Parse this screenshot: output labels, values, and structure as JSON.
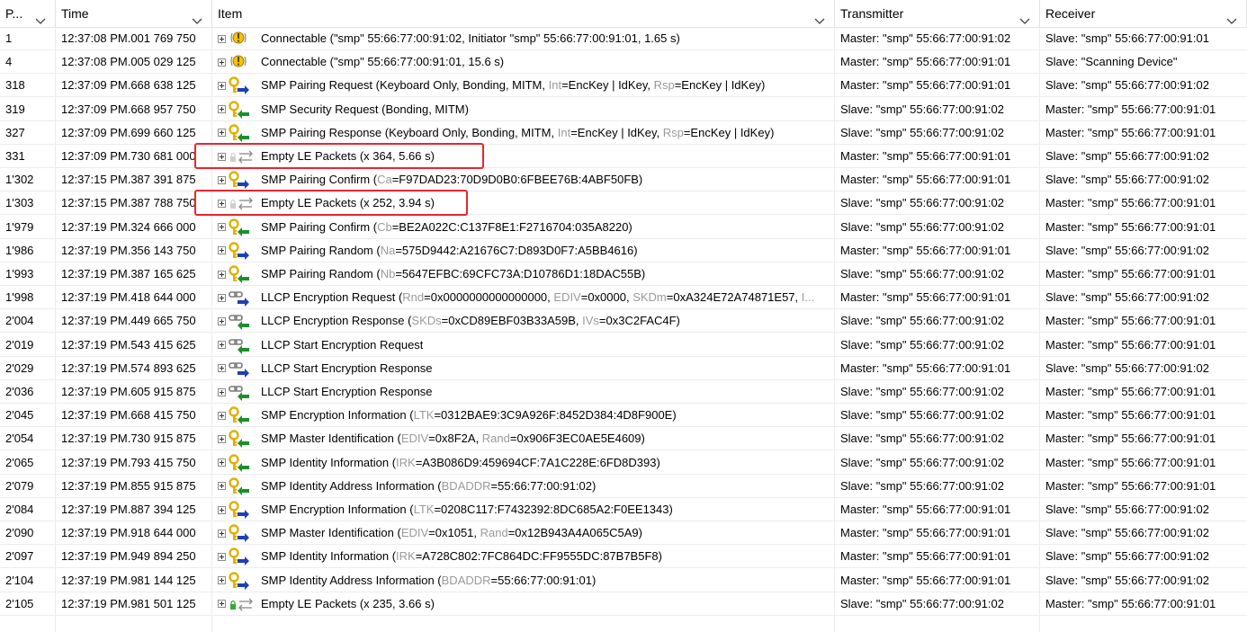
{
  "columns": [
    {
      "key": "packet",
      "label": "P..."
    },
    {
      "key": "time",
      "label": "Time"
    },
    {
      "key": "item",
      "label": "Item"
    },
    {
      "key": "transmitter",
      "label": "Transmitter"
    },
    {
      "key": "receiver",
      "label": "Receiver"
    }
  ],
  "rows": [
    {
      "packet": "1",
      "time": "12:37:08 PM.001 769 750",
      "icon": "connectable-icon",
      "parts": [
        [
          "Connectable (\"smp\" 55:66:77:00:91:02, Initiator \"smp\" 55:66:77:00:91:01, 1.65 s)",
          false
        ]
      ],
      "transmitter": "Master: \"smp\" 55:66:77:00:91:02",
      "receiver": "Slave: \"smp\" 55:66:77:00:91:01"
    },
    {
      "packet": "4",
      "time": "12:37:08 PM.005 029 125",
      "icon": "connectable-icon",
      "parts": [
        [
          "Connectable (\"smp\" 55:66:77:00:91:01, 15.6 s)",
          false
        ]
      ],
      "transmitter": "Master: \"smp\" 55:66:77:00:91:01",
      "receiver": "Slave: \"Scanning Device\""
    },
    {
      "packet": "318",
      "time": "12:37:09 PM.668 638 125",
      "icon": "smp-key-right-icon",
      "parts": [
        [
          "SMP Pairing Request (Keyboard Only, Bonding, MITM, ",
          false
        ],
        [
          "Int",
          true
        ],
        [
          "=EncKey | IdKey, ",
          false
        ],
        [
          "Rsp",
          true
        ],
        [
          "=EncKey | IdKey)",
          false
        ]
      ],
      "transmitter": "Master: \"smp\" 55:66:77:00:91:01",
      "receiver": "Slave: \"smp\" 55:66:77:00:91:02"
    },
    {
      "packet": "319",
      "time": "12:37:09 PM.668 957 750",
      "icon": "smp-key-left-icon",
      "parts": [
        [
          "SMP Security Request (Bonding, MITM)",
          false
        ]
      ],
      "transmitter": "Slave: \"smp\" 55:66:77:00:91:02",
      "receiver": "Master: \"smp\" 55:66:77:00:91:01"
    },
    {
      "packet": "327",
      "time": "12:37:09 PM.699 660 125",
      "icon": "smp-key-left-icon",
      "parts": [
        [
          "SMP Pairing Response (Keyboard Only, Bonding, MITM, ",
          false
        ],
        [
          "Int",
          true
        ],
        [
          "=EncKey | IdKey, ",
          false
        ],
        [
          "Rsp",
          true
        ],
        [
          "=EncKey | IdKey)",
          false
        ]
      ],
      "transmitter": "Slave: \"smp\" 55:66:77:00:91:02",
      "receiver": "Master: \"smp\" 55:66:77:00:91:01"
    },
    {
      "packet": "331",
      "time": "12:37:09 PM.730 681 000",
      "icon": "empty-packets-icon",
      "parts": [
        [
          "Empty LE Packets (x 364, 5.66 s)",
          false
        ]
      ],
      "transmitter": "Master: \"smp\" 55:66:77:00:91:01",
      "receiver": "Slave: \"smp\" 55:66:77:00:91:02"
    },
    {
      "packet": "1'302",
      "time": "12:37:15 PM.387 391 875",
      "icon": "smp-key-right-icon",
      "parts": [
        [
          "SMP Pairing Confirm (",
          false
        ],
        [
          "Ca",
          true
        ],
        [
          "=F97DAD23:70D9D0B0:6FBEE76B:4ABF50FB)",
          false
        ]
      ],
      "transmitter": "Master: \"smp\" 55:66:77:00:91:01",
      "receiver": "Slave: \"smp\" 55:66:77:00:91:02"
    },
    {
      "packet": "1'303",
      "time": "12:37:15 PM.387 788 750",
      "icon": "empty-packets-icon",
      "parts": [
        [
          "Empty LE Packets (x 252, 3.94 s)",
          false
        ]
      ],
      "transmitter": "Slave: \"smp\" 55:66:77:00:91:02",
      "receiver": "Master: \"smp\" 55:66:77:00:91:01"
    },
    {
      "packet": "1'979",
      "time": "12:37:19 PM.324 666 000",
      "icon": "smp-key-left-icon",
      "parts": [
        [
          "SMP Pairing Confirm (",
          false
        ],
        [
          "Cb",
          true
        ],
        [
          "=BE2A022C:C137F8E1:F2716704:035A8220)",
          false
        ]
      ],
      "transmitter": "Slave: \"smp\" 55:66:77:00:91:02",
      "receiver": "Master: \"smp\" 55:66:77:00:91:01"
    },
    {
      "packet": "1'986",
      "time": "12:37:19 PM.356 143 750",
      "icon": "smp-key-right-icon",
      "parts": [
        [
          "SMP Pairing Random (",
          false
        ],
        [
          "Na",
          true
        ],
        [
          "=575D9442:A21676C7:D893D0F7:A5BB4616)",
          false
        ]
      ],
      "transmitter": "Master: \"smp\" 55:66:77:00:91:01",
      "receiver": "Slave: \"smp\" 55:66:77:00:91:02"
    },
    {
      "packet": "1'993",
      "time": "12:37:19 PM.387 165 625",
      "icon": "smp-key-left-icon",
      "parts": [
        [
          "SMP Pairing Random (",
          false
        ],
        [
          "Nb",
          true
        ],
        [
          "=5647EFBC:69CFC73A:D10786D1:18DAC55B)",
          false
        ]
      ],
      "transmitter": "Slave: \"smp\" 55:66:77:00:91:02",
      "receiver": "Master: \"smp\" 55:66:77:00:91:01"
    },
    {
      "packet": "1'998",
      "time": "12:37:19 PM.418 644 000",
      "icon": "llcp-right-icon",
      "parts": [
        [
          "LLCP Encryption Request (",
          false
        ],
        [
          "Rnd",
          true
        ],
        [
          "=0x0000000000000000, ",
          false
        ],
        [
          "EDIV",
          true
        ],
        [
          "=0x0000, ",
          false
        ],
        [
          "SKDm",
          true
        ],
        [
          "=0xA324E72A74871E57, ",
          false
        ],
        [
          "I...",
          true
        ]
      ],
      "transmitter": "Master: \"smp\" 55:66:77:00:91:01",
      "receiver": "Slave: \"smp\" 55:66:77:00:91:02"
    },
    {
      "packet": "2'004",
      "time": "12:37:19 PM.449 665 750",
      "icon": "llcp-left-icon",
      "parts": [
        [
          "LLCP Encryption Response (",
          false
        ],
        [
          "SKDs",
          true
        ],
        [
          "=0xCD89EBF03B33A59B, ",
          false
        ],
        [
          "IVs",
          true
        ],
        [
          "=0x3C2FAC4F)",
          false
        ]
      ],
      "transmitter": "Slave: \"smp\" 55:66:77:00:91:02",
      "receiver": "Master: \"smp\" 55:66:77:00:91:01"
    },
    {
      "packet": "2'019",
      "time": "12:37:19 PM.543 415 625",
      "icon": "llcp-left-icon",
      "parts": [
        [
          "LLCP Start Encryption Request",
          false
        ]
      ],
      "transmitter": "Slave: \"smp\" 55:66:77:00:91:02",
      "receiver": "Master: \"smp\" 55:66:77:00:91:01"
    },
    {
      "packet": "2'029",
      "time": "12:37:19 PM.574 893 625",
      "icon": "llcp-right-icon",
      "parts": [
        [
          "LLCP Start Encryption Response",
          false
        ]
      ],
      "transmitter": "Master: \"smp\" 55:66:77:00:91:01",
      "receiver": "Slave: \"smp\" 55:66:77:00:91:02"
    },
    {
      "packet": "2'036",
      "time": "12:37:19 PM.605 915 875",
      "icon": "llcp-left-icon",
      "parts": [
        [
          "LLCP Start Encryption Response",
          false
        ]
      ],
      "transmitter": "Slave: \"smp\" 55:66:77:00:91:02",
      "receiver": "Master: \"smp\" 55:66:77:00:91:01"
    },
    {
      "packet": "2'045",
      "time": "12:37:19 PM.668 415 750",
      "icon": "smp-key-left-icon",
      "parts": [
        [
          "SMP Encryption Information (",
          false
        ],
        [
          "LTK",
          true
        ],
        [
          "=0312BAE9:3C9A926F:8452D384:4D8F900E)",
          false
        ]
      ],
      "transmitter": "Slave: \"smp\" 55:66:77:00:91:02",
      "receiver": "Master: \"smp\" 55:66:77:00:91:01"
    },
    {
      "packet": "2'054",
      "time": "12:37:19 PM.730 915 875",
      "icon": "smp-key-left-icon",
      "parts": [
        [
          "SMP Master Identification (",
          false
        ],
        [
          "EDIV",
          true
        ],
        [
          "=0x8F2A, ",
          false
        ],
        [
          "Rand",
          true
        ],
        [
          "=0x906F3EC0AE5E4609)",
          false
        ]
      ],
      "transmitter": "Slave: \"smp\" 55:66:77:00:91:02",
      "receiver": "Master: \"smp\" 55:66:77:00:91:01"
    },
    {
      "packet": "2'065",
      "time": "12:37:19 PM.793 415 750",
      "icon": "smp-key-left-icon",
      "parts": [
        [
          "SMP Identity Information (",
          false
        ],
        [
          "IRK",
          true
        ],
        [
          "=A3B086D9:459694CF:7A1C228E:6FD8D393)",
          false
        ]
      ],
      "transmitter": "Slave: \"smp\" 55:66:77:00:91:02",
      "receiver": "Master: \"smp\" 55:66:77:00:91:01"
    },
    {
      "packet": "2'079",
      "time": "12:37:19 PM.855 915 875",
      "icon": "smp-key-left-icon",
      "parts": [
        [
          "SMP Identity Address Information (",
          false
        ],
        [
          "BDADDR",
          true
        ],
        [
          "=55:66:77:00:91:02)",
          false
        ]
      ],
      "transmitter": "Slave: \"smp\" 55:66:77:00:91:02",
      "receiver": "Master: \"smp\" 55:66:77:00:91:01"
    },
    {
      "packet": "2'084",
      "time": "12:37:19 PM.887 394 125",
      "icon": "smp-key-right-icon",
      "parts": [
        [
          "SMP Encryption Information (",
          false
        ],
        [
          "LTK",
          true
        ],
        [
          "=0208C117:F7432392:8DC685A2:F0EE1343)",
          false
        ]
      ],
      "transmitter": "Master: \"smp\" 55:66:77:00:91:01",
      "receiver": "Slave: \"smp\" 55:66:77:00:91:02"
    },
    {
      "packet": "2'090",
      "time": "12:37:19 PM.918 644 000",
      "icon": "smp-key-right-icon",
      "parts": [
        [
          "SMP Master Identification (",
          false
        ],
        [
          "EDIV",
          true
        ],
        [
          "=0x1051, ",
          false
        ],
        [
          "Rand",
          true
        ],
        [
          "=0x12B943A4A065C5A9)",
          false
        ]
      ],
      "transmitter": "Master: \"smp\" 55:66:77:00:91:01",
      "receiver": "Slave: \"smp\" 55:66:77:00:91:02"
    },
    {
      "packet": "2'097",
      "time": "12:37:19 PM.949 894 250",
      "icon": "smp-key-right-icon",
      "parts": [
        [
          "SMP Identity Information (",
          false
        ],
        [
          "IRK",
          true
        ],
        [
          "=A728C802:7FC864DC:FF9555DC:87B7B5F8)",
          false
        ]
      ],
      "transmitter": "Master: \"smp\" 55:66:77:00:91:01",
      "receiver": "Slave: \"smp\" 55:66:77:00:91:02"
    },
    {
      "packet": "2'104",
      "time": "12:37:19 PM.981 144 125",
      "icon": "smp-key-right-icon",
      "parts": [
        [
          "SMP Identity Address Information (",
          false
        ],
        [
          "BDADDR",
          true
        ],
        [
          "=55:66:77:00:91:01)",
          false
        ]
      ],
      "transmitter": "Master: \"smp\" 55:66:77:00:91:01",
      "receiver": "Slave: \"smp\" 55:66:77:00:91:02"
    },
    {
      "packet": "2'105",
      "time": "12:37:19 PM.981 501 125",
      "icon": "empty-packets-encrypted-icon",
      "parts": [
        [
          "Empty LE Packets (x 235, 3.66 s)",
          false
        ]
      ],
      "transmitter": "Slave: \"smp\" 55:66:77:00:91:02",
      "receiver": "Master: \"smp\" 55:66:77:00:91:01"
    }
  ],
  "highlighted_rows": [
    "331",
    "1'303"
  ],
  "colors": {
    "highlight": "#e8262c",
    "dim_text": "#9a9a9a",
    "key": "#e0b000",
    "arrow_blue": "#1f3fb3",
    "arrow_green": "#1c8f2b"
  }
}
